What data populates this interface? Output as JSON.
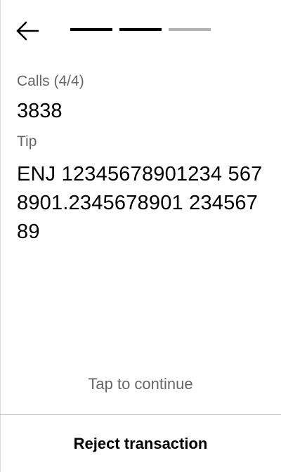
{
  "header": {
    "back_icon": "arrow-left-icon",
    "progress": {
      "total_steps": 3,
      "completed_steps": 2,
      "active_color": "#000000",
      "inactive_color": "#b3b3b3"
    }
  },
  "calls": {
    "label": "Calls (4/4)",
    "value": "3838"
  },
  "tip": {
    "label": "Tip",
    "value": "ENJ 12345678901234 5678901.2345678901 23456789"
  },
  "footer": {
    "tap_to_continue": "Tap to continue",
    "reject_label": "Reject transaction"
  }
}
